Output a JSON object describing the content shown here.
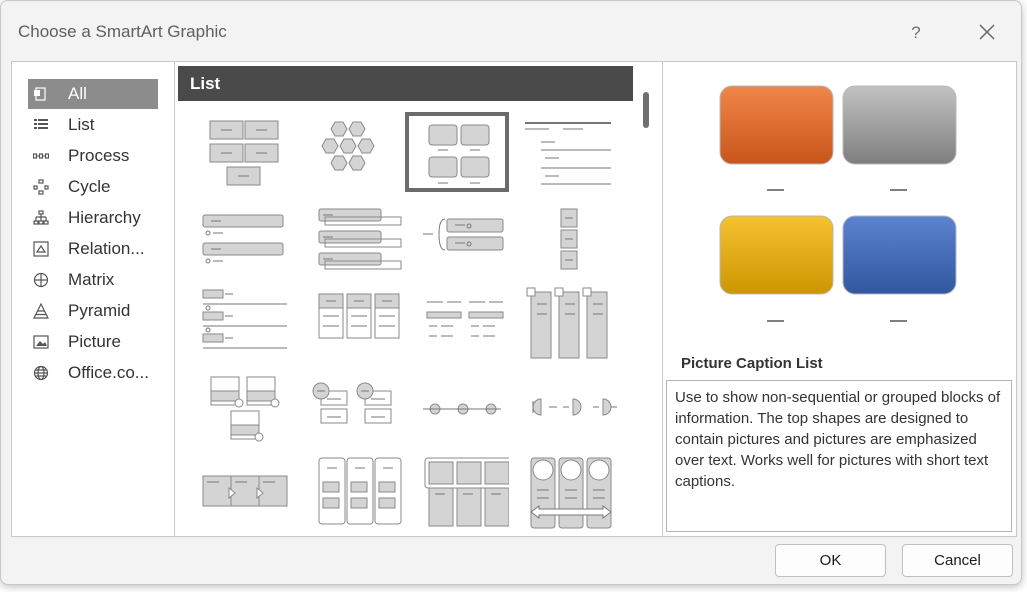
{
  "dialog": {
    "title": "Choose a SmartArt Graphic"
  },
  "titlebar": {
    "help_label": "?"
  },
  "categories": [
    {
      "label": "All",
      "icon": "all-icon",
      "selected": true
    },
    {
      "label": "List",
      "icon": "list-icon"
    },
    {
      "label": "Process",
      "icon": "process-icon"
    },
    {
      "label": "Cycle",
      "icon": "cycle-icon"
    },
    {
      "label": "Hierarchy",
      "icon": "hierarchy-icon"
    },
    {
      "label": "Relation...",
      "icon": "relationship-icon"
    },
    {
      "label": "Matrix",
      "icon": "matrix-icon"
    },
    {
      "label": "Pyramid",
      "icon": "pyramid-icon"
    },
    {
      "label": "Picture",
      "icon": "picture-icon"
    },
    {
      "label": "Office.co...",
      "icon": "globe-icon"
    }
  ],
  "gallery": {
    "header": "List"
  },
  "preview": {
    "title": "Picture Caption List",
    "description": "Use to show non-sequential or grouped blocks of information. The top shapes are designed to contain pictures and pictures are emphasized over text. Works well for pictures with short text captions.",
    "block_colors": [
      "#d9611e",
      "#8e8e8e",
      "#e3ac0e",
      "#4168b8"
    ]
  },
  "buttons": {
    "ok": "OK",
    "cancel": "Cancel"
  }
}
